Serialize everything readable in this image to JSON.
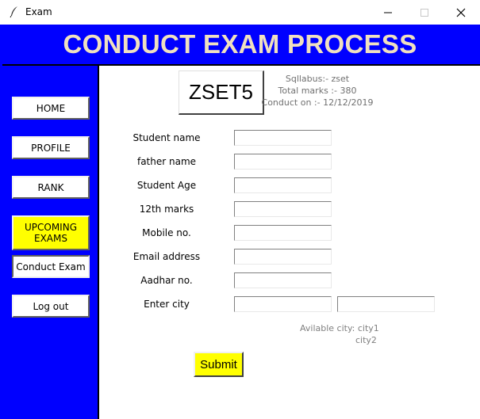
{
  "window": {
    "title": "Exam",
    "icons": {
      "app": "feather-icon",
      "minimize": "minimize-icon",
      "maximize": "maximize-icon",
      "close": "close-icon"
    }
  },
  "banner": {
    "title": "CONDUCT EXAM PROCESS"
  },
  "nav": {
    "home": "HOME",
    "profile": "PROFILE",
    "rank": "RANK",
    "upcoming_line1": "UPCOMING",
    "upcoming_line2": "EXAMS",
    "conduct": "Conduct Exam",
    "logout": "Log out"
  },
  "exam": {
    "set_name": "ZSET5",
    "syllabus": "Sqllabus:- zset",
    "total_marks": "Total marks :- 380",
    "conduct_on": "Conduct on :- 12/12/2019"
  },
  "form": {
    "student_name": {
      "label": "Student name",
      "value": ""
    },
    "father_name": {
      "label": "father name",
      "value": ""
    },
    "student_age": {
      "label": "Student Age",
      "value": ""
    },
    "marks_12th": {
      "label": "12th marks",
      "value": ""
    },
    "mobile": {
      "label": "Mobile no.",
      "value": ""
    },
    "email": {
      "label": "Email address",
      "value": ""
    },
    "aadhar": {
      "label": "Aadhar no.",
      "value": ""
    },
    "city": {
      "label": "Enter city",
      "value": "",
      "second_value": ""
    },
    "available_city_label": "Avilable city: city1",
    "available_city_2": "city2",
    "submit": "Submit"
  },
  "colors": {
    "banner": "#0000ff",
    "sidebar": "#0000ff",
    "banner_text": "#f0e0c0",
    "highlight": "#ffff00"
  }
}
